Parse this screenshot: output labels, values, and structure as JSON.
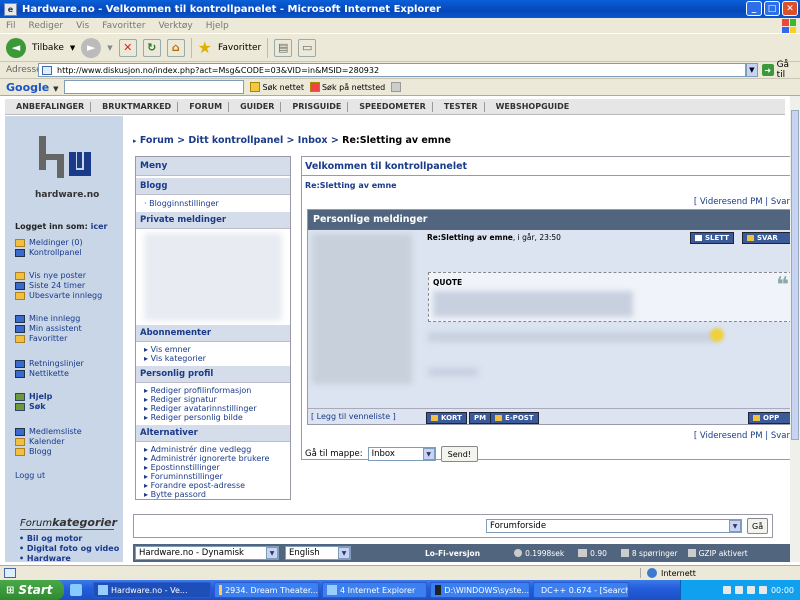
{
  "window": {
    "title": "Hardware.no - Velkommen til kontrollpanelet - Microsoft Internet Explorer"
  },
  "menubar": [
    "Fil",
    "Rediger",
    "Vis",
    "Favoritter",
    "Verktøy",
    "Hjelp"
  ],
  "toolbar": {
    "back": "Tilbake",
    "favorites": "Favoritter"
  },
  "address": {
    "label": "Adresse",
    "url": "http://www.diskusjon.no/index.php?act=Msg&CODE=03&VID=in&MSID=280932",
    "go": "Gå til"
  },
  "google": {
    "logo": "Google",
    "search_web": "Søk nettet",
    "search_site": "Søk på nettsted"
  },
  "topnav": [
    "ANBEFALINGER",
    "BRUKTMARKED",
    "FORUM",
    "GUIDER",
    "PRISGUIDE",
    "SPEEDOMETER",
    "TESTER",
    "WEBSHOPGUIDE"
  ],
  "sidebar": {
    "logo_text": "hardware.no",
    "logged_in_label": "Logget inn som:",
    "username": "icer",
    "groups": [
      [
        "Meldinger (0)",
        "Kontrollpanel"
      ],
      [
        "Vis nye poster",
        "Siste 24 timer",
        "Ubesvarte innlegg"
      ],
      [
        "Mine innlegg",
        "Min assistent",
        "Favoritter"
      ],
      [
        "Retningslinjer",
        "Nettikette"
      ],
      [
        "Hjelp",
        "Søk"
      ],
      [
        "Medlemsliste",
        "Kalender",
        "Blogg"
      ],
      [
        "Logg ut"
      ]
    ],
    "forum_cat_prefix": "Forum",
    "forum_cat_suffix": "kategorier",
    "cat_items": [
      "Bil og motor",
      "Digital foto og video",
      "Hardware"
    ]
  },
  "breadcrumb": {
    "items": [
      "Forum",
      "Ditt kontrollpanel",
      "Inbox"
    ],
    "current": "Re:Sletting av emne"
  },
  "menu": {
    "title": "Meny",
    "sections": [
      {
        "title": "Blogg",
        "items": [
          "Blogginnstillinger"
        ]
      },
      {
        "title": "Private meldinger",
        "items": []
      },
      {
        "title": "Abonnementer",
        "items": [
          "Vis emner",
          "Vis kategorier"
        ]
      },
      {
        "title": "Personlig profil",
        "items": [
          "Rediger profilinformasjon",
          "Rediger signatur",
          "Rediger avatarinnstillinger",
          "Rediger personlig bilde"
        ]
      },
      {
        "title": "Alternativer",
        "items": [
          "Administrér dine vedlegg",
          "Administrér ignorerte brukere",
          "Epostinnstillinger",
          "Foruminnstillinger",
          "Forandre epost-adresse",
          "Bytte passord"
        ]
      }
    ]
  },
  "main": {
    "title": "Velkommen til kontrollpanelet",
    "subtitle": "Re:Sletting av emne",
    "forward": "[ Videresend PM | Svar",
    "pm_header": "Personlige meldinger",
    "msg_title": "Re:Sletting av emne",
    "msg_date": ", i går, 23:50",
    "delete": "SLETT",
    "reply": "SVAR",
    "quote": "QUOTE",
    "add_friend": "[ Legg til venneliste ]",
    "card": "KORT",
    "pm": "PM",
    "email": "E-POST",
    "up": "OPP",
    "goto_label": "Gå til mappe:",
    "goto_value": "Inbox",
    "send": "Send!"
  },
  "jump": {
    "value": "Forumforside",
    "go": "Gå"
  },
  "footer": {
    "skin": "Hardware.no - Dynamisk",
    "lang": "English",
    "lofi": "Lo-Fi-versjon",
    "time": "0.1998sek",
    "load": "0.90",
    "queries": "8 spørringer",
    "gzip": "GZIP aktivert"
  },
  "statusbar": {
    "zone": "Internett"
  },
  "taskbar": {
    "start": "Start",
    "tasks": [
      "Hardware.no - Ve...",
      "2934. Dream Theater...",
      "4 Internet Explorer",
      "D:\\WINDOWS\\syste...",
      "DC++ 0.674 - [Search]"
    ],
    "clock": "00:00"
  }
}
